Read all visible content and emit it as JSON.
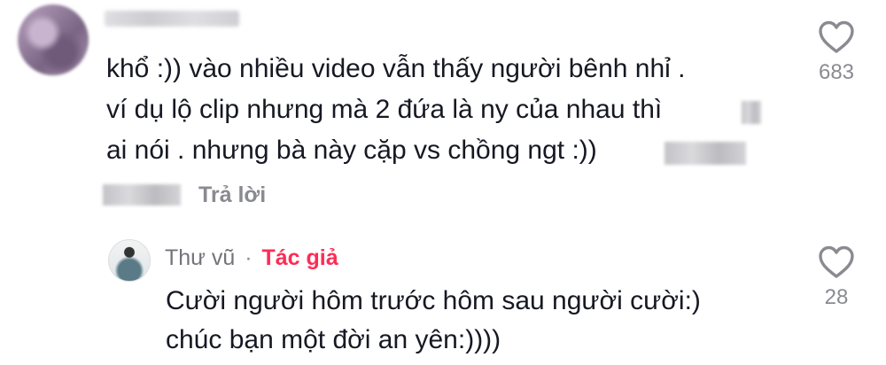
{
  "comment": {
    "lines": [
      "khổ :)) vào nhiều video vẫn thấy người bênh nhỉ .",
      "ví dụ lộ clip nhưng mà 2 đứa là ny của nhau thì",
      "ai nói . nhưng bà này cặp vs chồng ngt :))"
    ],
    "reply_label": "Trả lời",
    "like_count": "683"
  },
  "reply": {
    "author": "Thư vũ",
    "separator": "·",
    "author_tag": "Tác giả",
    "lines": [
      "Cười người hôm trước hôm sau người cười:)",
      "chúc bạn một đời an yên:))))"
    ],
    "like_count": "28"
  },
  "icons": {
    "like": "heart-outline-icon"
  },
  "colors": {
    "author_tag": "#fe2c55",
    "muted": "#8a8b91",
    "text": "#161823"
  }
}
